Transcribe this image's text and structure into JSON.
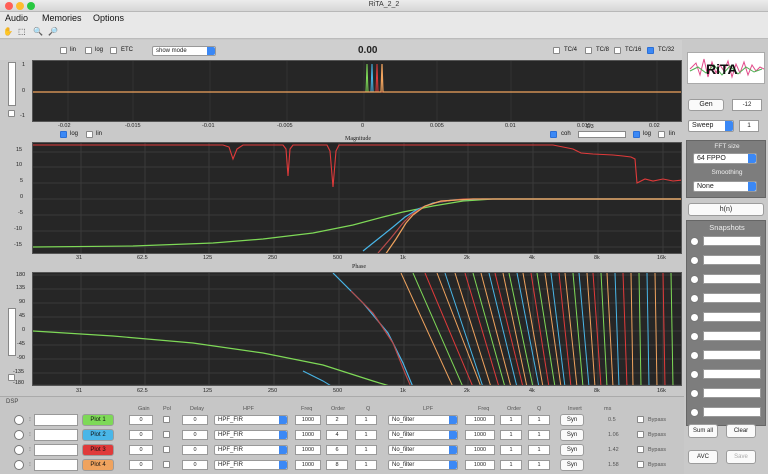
{
  "window": {
    "title": "RiTA_2_2"
  },
  "menu": [
    {
      "id": "audio",
      "label": "Audio",
      "x": 5
    },
    {
      "id": "memories",
      "label": "Memories",
      "x": 42
    },
    {
      "id": "options",
      "label": "Options",
      "x": 93
    }
  ],
  "top_panel": {
    "lin_label": "lin",
    "log_label": "log",
    "etc_label": "ETC",
    "mode_select": "show mode",
    "value_readout": "0.00",
    "tc": [
      {
        "label": "TC/4",
        "on": false
      },
      {
        "label": "TC/8",
        "on": false
      },
      {
        "label": "TC/16",
        "on": false
      },
      {
        "label": "TC/32",
        "on": true
      }
    ],
    "y_ticks": [
      "1",
      "0",
      "-1"
    ],
    "x_ticks": [
      "-0.02",
      "-0.015",
      "-0.01",
      "-0.005",
      "0",
      "0.005",
      "0.01",
      "0.015",
      "0.02"
    ]
  },
  "mid_controls": {
    "log_label": "log",
    "lin_label": "lin",
    "coh_label": "coh",
    "log2_label": "log",
    "lin2_label": "lin",
    "slider_value": "1/3"
  },
  "magnitude_panel": {
    "title": "Magnitude",
    "y_ticks": [
      "15",
      "10",
      "5",
      "0",
      "-5",
      "-10",
      "-15"
    ],
    "x_ticks": [
      "31",
      "62.5",
      "125",
      "250",
      "500",
      "1k",
      "2k",
      "4k",
      "8k",
      "16k"
    ]
  },
  "phase_panel": {
    "title": "Phase",
    "y_ticks": [
      "180",
      "135",
      "90",
      "45",
      "0",
      "-45",
      "-90",
      "-135",
      "-180"
    ],
    "x_ticks": [
      "31",
      "62.5",
      "125",
      "250",
      "500",
      "1k",
      "2k",
      "4k",
      "8k",
      "16k"
    ]
  },
  "right_panel": {
    "logo_text": "RiTA",
    "gen_label": "Gen",
    "gen_level": "-12",
    "sweep_select": "Sweep",
    "sweep_count": "1",
    "fft_label": "FFT size",
    "fft_select": "64 FPPO",
    "smoothing_label": "Smoothing",
    "smoothing_select": "None",
    "hn_button": "h(n)",
    "snapshots_label": "Snapshots",
    "snapshot_count": 10,
    "sum_all": "Sum all",
    "clear": "Clear",
    "avc": "AVC",
    "save": "Save"
  },
  "dsp": {
    "label": "DSP",
    "headers": [
      "Gain",
      "Pol",
      "Delay",
      "HPF",
      "Freq",
      "Order",
      "Q",
      "LPF",
      "Freq",
      "Order",
      "Q",
      "Invert",
      "ms"
    ],
    "rows": [
      {
        "plot": "Plot 1",
        "color": "#7ed957",
        "gain": "0",
        "delay": "0",
        "hpf": "HPF_FIR",
        "hfreq": "1000",
        "horder": "2",
        "hq": "1",
        "lpf": "No_filter",
        "lfreq": "1000",
        "lorder": "1",
        "lq": "1",
        "syn": "Syn",
        "ms": "0.5",
        "bypass": "Bypass"
      },
      {
        "plot": "Plot 2",
        "color": "#49b6e8",
        "gain": "0",
        "delay": "0",
        "hpf": "HPF_FIR",
        "hfreq": "1000",
        "horder": "4",
        "hq": "1",
        "lpf": "No_filter",
        "lfreq": "1000",
        "lorder": "1",
        "lq": "1",
        "syn": "Syn",
        "ms": "1.06",
        "bypass": "Bypass"
      },
      {
        "plot": "Plot 3",
        "color": "#e03a3a",
        "gain": "0",
        "delay": "0",
        "hpf": "HPF_FIR",
        "hfreq": "1000",
        "horder": "6",
        "hq": "1",
        "lpf": "No_filter",
        "lfreq": "1000",
        "lorder": "1",
        "lq": "1",
        "syn": "Syn",
        "ms": "1.42",
        "bypass": "Bypass"
      },
      {
        "plot": "Plot 4",
        "color": "#f0a35e",
        "gain": "0",
        "delay": "0",
        "hpf": "HPF_FIR",
        "hfreq": "1000",
        "horder": "8",
        "hq": "1",
        "lpf": "No_filter",
        "lfreq": "1000",
        "lorder": "1",
        "lq": "1",
        "syn": "Syn",
        "ms": "1.58",
        "bypass": "Bypass"
      }
    ]
  },
  "colors": {
    "green": "#7ed957",
    "blue": "#49b6e8",
    "red": "#e03a3a",
    "orange": "#f0a35e",
    "accent": "#3b88f5"
  }
}
